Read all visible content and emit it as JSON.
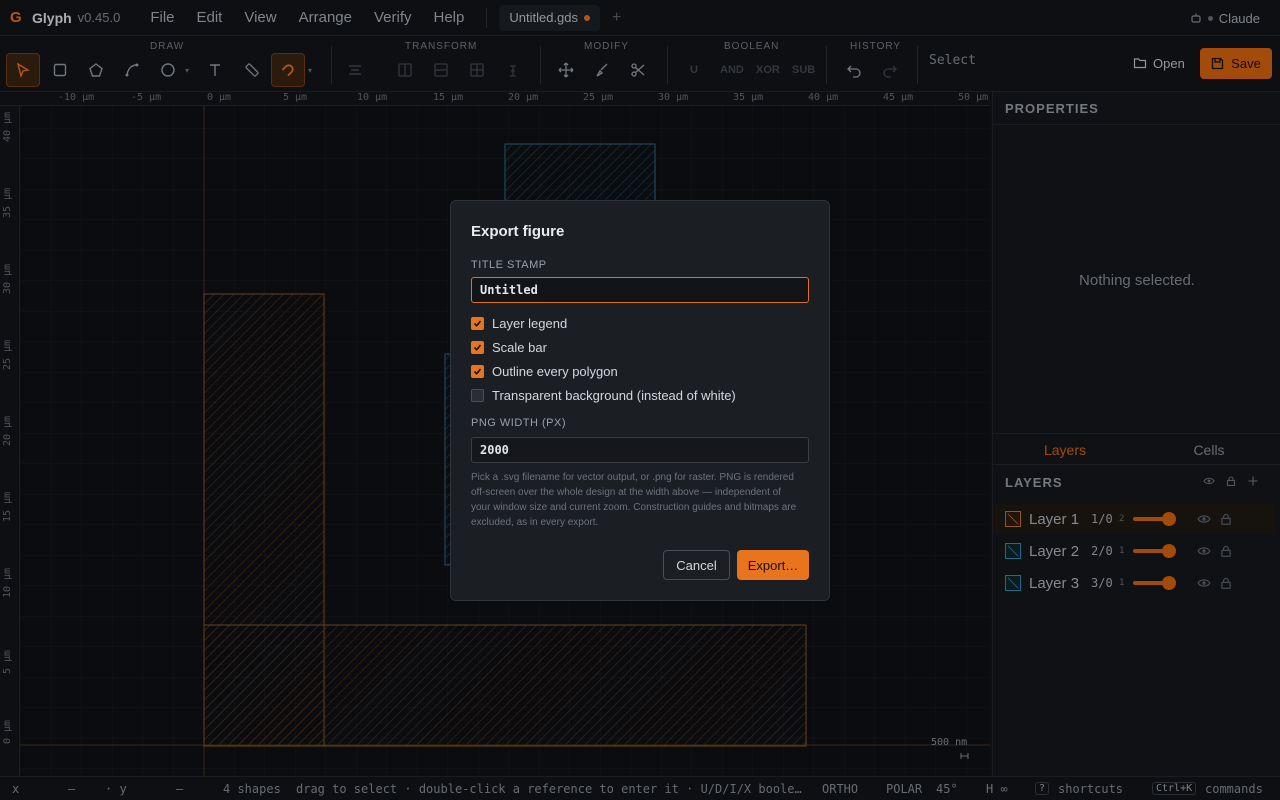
{
  "app": {
    "name": "Glyph",
    "version": "v0.45.0",
    "user": "Claude"
  },
  "menu": [
    "File",
    "Edit",
    "View",
    "Arrange",
    "Verify",
    "Help"
  ],
  "document_tab": {
    "name": "Untitled.gds",
    "unsaved": true
  },
  "toolbar": {
    "groups": {
      "draw": "DRAW",
      "transform": "TRANSFORM",
      "modify": "MODIFY",
      "boolean": "BOOLEAN",
      "history": "HISTORY"
    },
    "boolean_ops": [
      "U",
      "AND",
      "XOR",
      "SUB"
    ],
    "mode_label": "Select",
    "open_label": "Open",
    "save_label": "Save",
    "icons": [
      "select-icon",
      "rectangle-icon",
      "polygon-icon",
      "path-icon",
      "circle-icon",
      "text-icon",
      "ruler-icon",
      "snap-icon",
      "align-icon",
      "flip-h-icon",
      "flip-v-icon",
      "grid-icon",
      "anchor-icon",
      "move-icon",
      "brush-icon",
      "scissors-icon",
      "undo-icon",
      "redo-icon"
    ]
  },
  "canvas": {
    "x_ticks": [
      "-10 µm",
      "-5 µm",
      "0 µm",
      "5 µm",
      "10 µm",
      "15 µm",
      "20 µm",
      "25 µm",
      "30 µm",
      "35 µm",
      "40 µm",
      "45 µm",
      "50 µm"
    ],
    "y_ticks": [
      "40 µm",
      "35 µm",
      "30 µm",
      "25 µm",
      "20 µm",
      "15 µm",
      "10 µm",
      "5 µm",
      "0 µm"
    ],
    "scale_bar": "500 nm",
    "colors": {
      "layer1": "#c8732a",
      "layer2": "#2a8fb0",
      "layer3": "#2a8fb0"
    }
  },
  "properties": {
    "title": "PROPERTIES",
    "empty_text": "Nothing selected."
  },
  "panel_tabs": [
    "Layers",
    "Cells"
  ],
  "layers": {
    "title": "LAYERS",
    "items": [
      {
        "name": "Layer 1",
        "count": "1/0",
        "sub": "2",
        "color": "#c8732a",
        "opacity": 1.0
      },
      {
        "name": "Layer 2",
        "count": "2/0",
        "sub": "1",
        "color": "#2a8fb0",
        "opacity": 1.0
      },
      {
        "name": "Layer 3",
        "count": "3/0",
        "sub": "1",
        "color": "#2a8fb0",
        "opacity": 1.0
      }
    ]
  },
  "status": {
    "x_label": "x",
    "x_value": "—",
    "y_label": "· y",
    "y_value": "—",
    "shapes": "4 shapes",
    "hint": "drag to select · double-click a reference to enter it · U/D/I/X boole…",
    "ortho": "ORTHO",
    "polar": "POLAR",
    "polar_angle": "45°",
    "h": "H ∞",
    "shortcuts_key": "?",
    "shortcuts": "shortcuts",
    "commands_key": "Ctrl+K",
    "commands": "commands"
  },
  "dialog": {
    "title": "Export figure",
    "title_stamp_label": "TITLE STAMP",
    "title_stamp_value": "Untitled",
    "options": [
      {
        "label": "Layer legend",
        "checked": true
      },
      {
        "label": "Scale bar",
        "checked": true
      },
      {
        "label": "Outline every polygon",
        "checked": true
      },
      {
        "label": "Transparent background (instead of white)",
        "checked": false
      }
    ],
    "png_width_label": "PNG WIDTH (PX)",
    "png_width_value": "2000",
    "help_text": "Pick a .svg filename for vector output, or .png for raster. PNG is rendered off-screen over the whole design at the width above — independent of your window size and current zoom. Construction guides and bitmaps are excluded, as in every export.",
    "cancel_label": "Cancel",
    "export_label": "Export…"
  }
}
